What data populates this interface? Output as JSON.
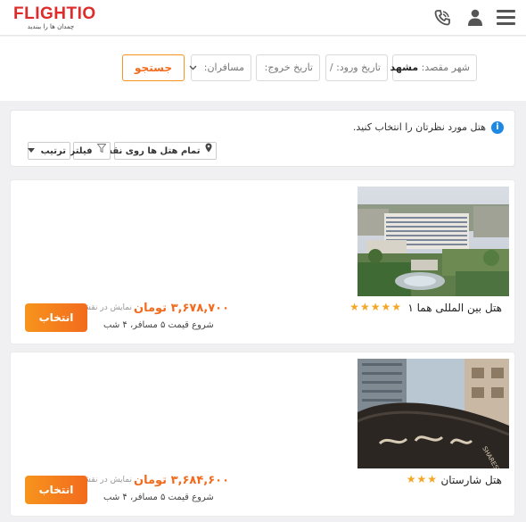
{
  "header": {
    "logo": "FLIGHTIO",
    "tagline": "چمدان ها را ببندید"
  },
  "search": {
    "destination_label": "شهر مقصد:",
    "destination_value": "مشهد",
    "checkin_label": "تاریخ ورود:",
    "checkin_value": "/",
    "checkout_label": "تاریخ خروج:",
    "passengers_label": "مسافران:",
    "search_button": "جستجو"
  },
  "info": {
    "message": "هتل مورد نظرتان را انتخاب کنید.",
    "map_chip": "تمام هتل ها روی نقشه",
    "filter_chip": "فیلتر",
    "sort_chip": "ترتیب"
  },
  "hotels": [
    {
      "name": "هتل بین المللی هما ۱",
      "stars": 5,
      "price": "۳,۶۷۸,۷۰۰ تومان",
      "show_text": "نمایش در نقشه",
      "start_text": "شروع قیمت ۵ مسافر، ۴ شب",
      "select_label": "انتخاب"
    },
    {
      "name": "هتل شارستان",
      "stars": 3,
      "price": "۳,۶۸۴,۶۰۰ تومان",
      "show_text": "نمایش در نقشه",
      "start_text": "شروع قیمت ۵ مسافر، ۴ شب",
      "select_label": "انتخاب"
    }
  ],
  "colors": {
    "brand_red": "#e02b2b",
    "accent_orange": "#f26b1d",
    "star": "#f5a623",
    "info_blue": "#1e88e5"
  },
  "icons": [
    "menu-icon",
    "user-icon",
    "phone-icon",
    "info-icon",
    "map-pin-icon",
    "filter-icon",
    "dropdown-icon",
    "star-icon"
  ]
}
